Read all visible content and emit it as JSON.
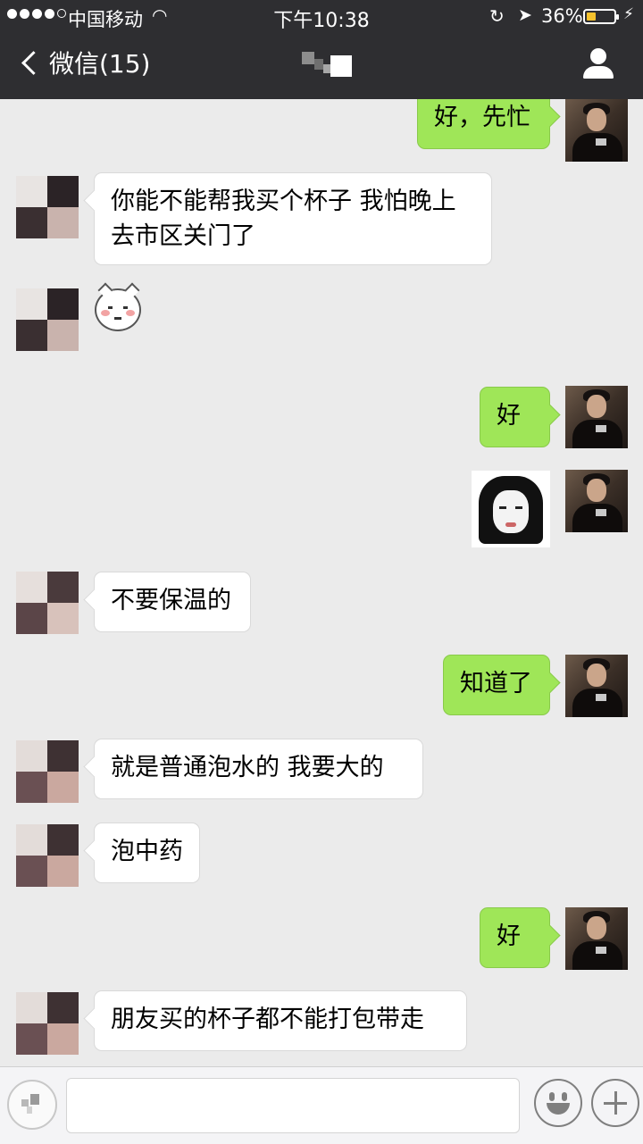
{
  "status_bar": {
    "carrier": "中国移动",
    "time": "下午10:38",
    "battery": "36%",
    "battery_level": 0.36
  },
  "nav": {
    "back_label": "微信(15)"
  },
  "messages": [
    {
      "side": "right",
      "type": "text",
      "text": "好，先忙"
    },
    {
      "side": "left",
      "type": "text",
      "text": "你能不能帮我买个杯子  我怕晚上去市区关门了"
    },
    {
      "side": "left",
      "type": "sticker",
      "sticker": "cat-blush-sticker"
    },
    {
      "side": "right",
      "type": "text",
      "text": "好"
    },
    {
      "side": "right",
      "type": "sticker",
      "sticker": "girl-meme-sticker"
    },
    {
      "side": "left",
      "type": "text",
      "text": "不要保温的"
    },
    {
      "side": "right",
      "type": "text",
      "text": "知道了"
    },
    {
      "side": "left",
      "type": "text",
      "text": "就是普通泡水的   我要大的"
    },
    {
      "side": "left",
      "type": "text",
      "text": "泡中药"
    },
    {
      "side": "right",
      "type": "text",
      "text": "好"
    },
    {
      "side": "left",
      "type": "text",
      "text": "朋友买的杯子都不能打包带走"
    }
  ],
  "input_bar": {
    "input_value": "",
    "icons": [
      "voice-icon",
      "emoji-icon",
      "plus-icon"
    ]
  },
  "colors": {
    "nav_bg": "#2e2e31",
    "chat_bg": "#ebebeb",
    "my_bubble": "#9fe658",
    "friend_bubble": "#ffffff"
  }
}
